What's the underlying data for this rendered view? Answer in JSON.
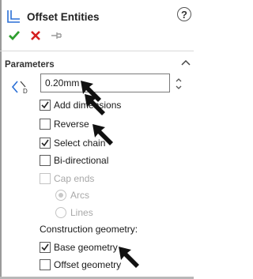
{
  "header": {
    "title": "Offset Entities",
    "help_label": "?"
  },
  "actions": {
    "ok_icon": "checkmark-icon",
    "cancel_icon": "x-icon",
    "pin_icon": "pushpin-icon"
  },
  "section": {
    "title": "Parameters"
  },
  "offset": {
    "value": "0.20mm"
  },
  "options": {
    "add_dimensions": {
      "label": "Add dimensions",
      "checked": true
    },
    "reverse": {
      "label": "Reverse",
      "checked": false
    },
    "select_chain": {
      "label": "Select chain",
      "checked": true
    },
    "bi_directional": {
      "label": "Bi-directional",
      "checked": false
    },
    "cap_ends": {
      "label": "Cap ends",
      "checked": false,
      "enabled": false
    },
    "arcs": {
      "label": "Arcs",
      "selected": true,
      "enabled": false
    },
    "lines": {
      "label": "Lines",
      "selected": false,
      "enabled": false
    }
  },
  "construction": {
    "label": "Construction geometry:",
    "base_geometry": {
      "label": "Base geometry",
      "checked": true
    },
    "offset_geometry": {
      "label": "Offset geometry",
      "checked": false
    }
  },
  "colors": {
    "ok_green": "#2e9e2e",
    "cancel_red": "#d42020",
    "accent_blue": "#2a6fd6"
  }
}
